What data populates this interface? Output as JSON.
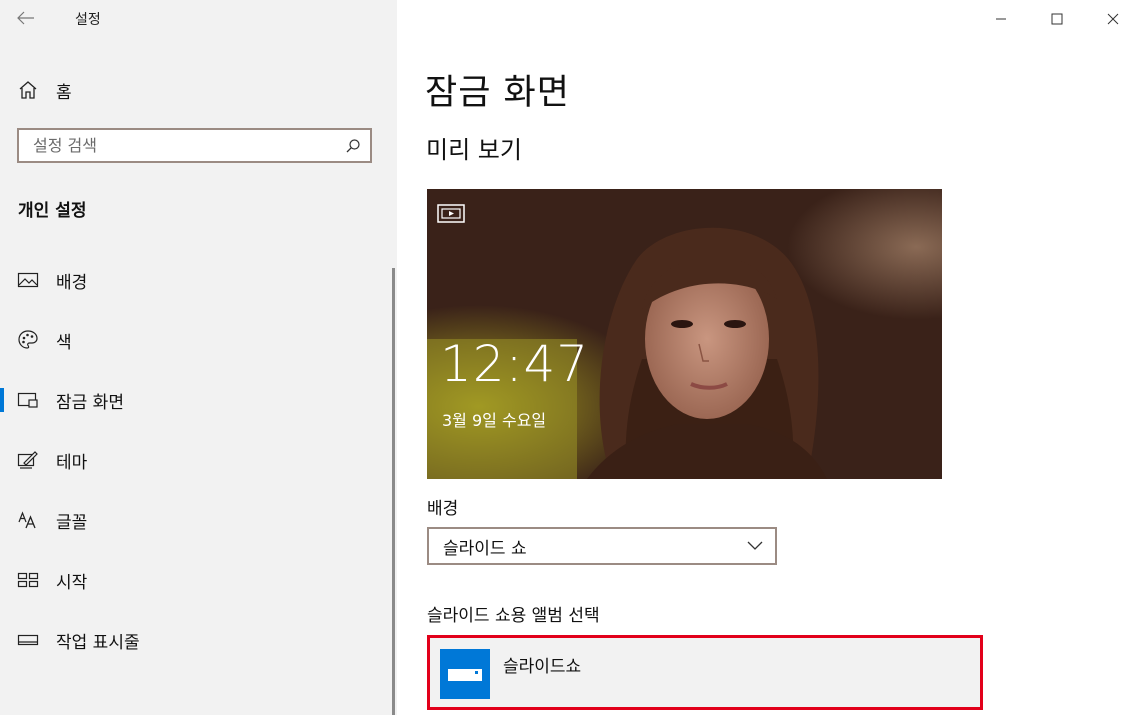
{
  "app": {
    "title": "설정"
  },
  "sidebar": {
    "home_label": "홈",
    "search": {
      "placeholder": "설정 검색"
    },
    "section_title": "개인 설정",
    "items": [
      {
        "label": "배경",
        "icon": "picture-icon"
      },
      {
        "label": "색",
        "icon": "palette-icon"
      },
      {
        "label": "잠금 화면",
        "icon": "lock-screen-icon",
        "selected": true
      },
      {
        "label": "테마",
        "icon": "theme-brush-icon"
      },
      {
        "label": "글꼴",
        "icon": "font-icon"
      },
      {
        "label": "시작",
        "icon": "start-tiles-icon"
      },
      {
        "label": "작업 표시줄",
        "icon": "taskbar-icon"
      }
    ]
  },
  "window_controls": [
    "minimize",
    "maximize",
    "close"
  ],
  "main": {
    "title": "잠금 화면",
    "preview_heading": "미리 보기",
    "preview": {
      "time": "12:47",
      "date": "3월 9일 수요일"
    },
    "background_label": "배경",
    "background_value": "슬라이드 쇼",
    "album_label": "슬라이드 쇼용 앨범 선택",
    "album_item": "슬라이드쇼"
  },
  "colors": {
    "accent": "#0078d7",
    "sidebar_bg": "#f2f2f2",
    "highlight_border": "#e2001a",
    "field_border": "#9b8b83"
  }
}
